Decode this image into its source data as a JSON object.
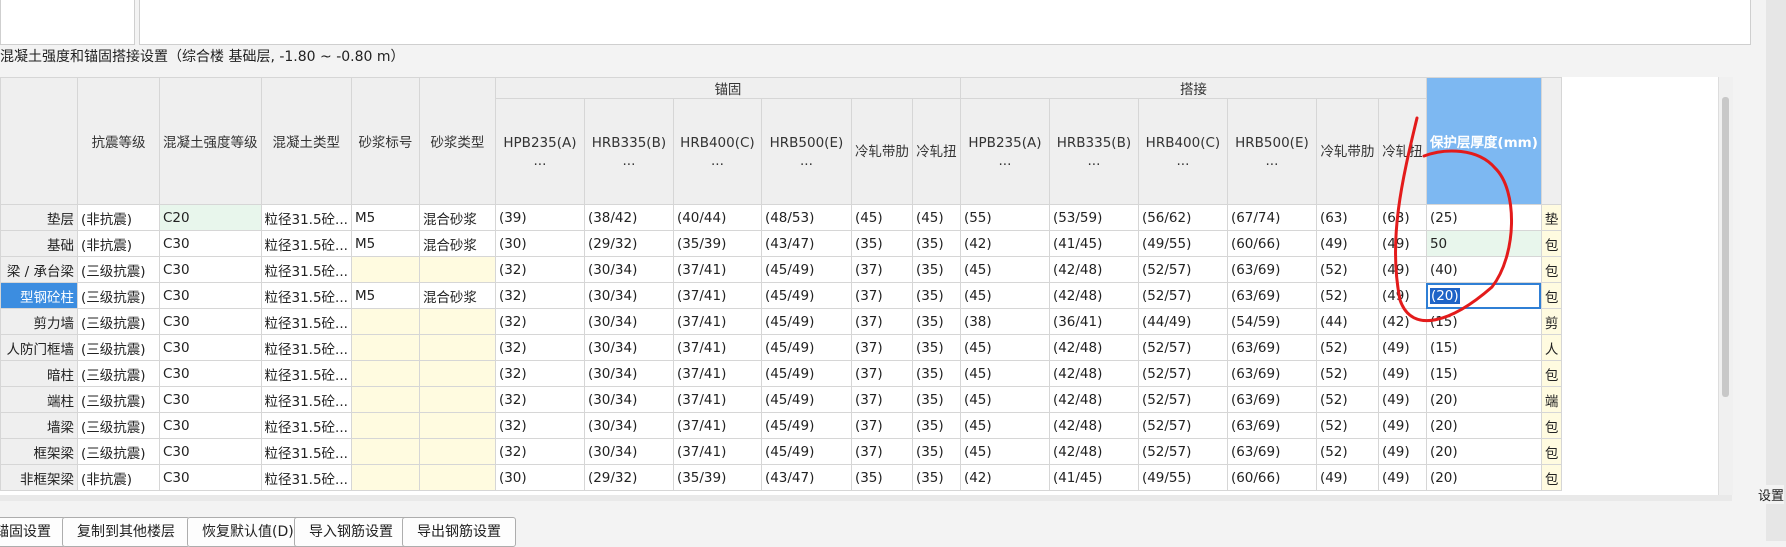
{
  "section_title": "混凝土强度和锚固搭接设置（综合楼  基础层, -1.80 ~ -0.80 m）",
  "table": {
    "group_headers": {
      "anchor": "锚固",
      "lap": "搭接"
    },
    "columns": [
      "",
      "抗震等级",
      "混凝土强度等级",
      "混凝土类型",
      "砂浆标号",
      "砂浆类型",
      "HPB235(A)\n...",
      "HRB335(B)\n...",
      "HRB400(C)\n...",
      "HRB500(E)\n...",
      "冷轧带肋",
      "冷轧扭",
      "HPB235(A)\n...",
      "HRB335(B)\n...",
      "HRB400(C)\n...",
      "HRB500(E)\n...",
      "冷轧带肋",
      "冷轧扭",
      "保护层厚度(mm)",
      ""
    ],
    "rows": [
      [
        "垫层",
        "(非抗震)",
        "C20",
        "粒径31.5砼...",
        "M5",
        "混合砂浆",
        "(39)",
        "(38/42)",
        "(40/44)",
        "(48/53)",
        "(45)",
        "(45)",
        "(55)",
        "(53/59)",
        "(56/62)",
        "(67/74)",
        "(63)",
        "(63)",
        "(25)",
        "垫"
      ],
      [
        "基础",
        "(非抗震)",
        "C30",
        "粒径31.5砼...",
        "M5",
        "混合砂浆",
        "(30)",
        "(29/32)",
        "(35/39)",
        "(43/47)",
        "(35)",
        "(35)",
        "(42)",
        "(41/45)",
        "(49/55)",
        "(60/66)",
        "(49)",
        "(49)",
        "50",
        "包"
      ],
      [
        "梁 / 承台梁",
        "(三级抗震)",
        "C30",
        "粒径31.5砼...",
        "",
        "",
        "(32)",
        "(30/34)",
        "(37/41)",
        "(45/49)",
        "(37)",
        "(35)",
        "(45)",
        "(42/48)",
        "(52/57)",
        "(63/69)",
        "(52)",
        "(49)",
        "(40)",
        "包"
      ],
      [
        "型钢砼柱",
        "(三级抗震)",
        "C30",
        "粒径31.5砼...",
        "M5",
        "混合砂浆",
        "(32)",
        "(30/34)",
        "(37/41)",
        "(45/49)",
        "(37)",
        "(35)",
        "(45)",
        "(42/48)",
        "(52/57)",
        "(63/69)",
        "(52)",
        "(49)",
        "(20)",
        "包"
      ],
      [
        "剪力墙",
        "(三级抗震)",
        "C30",
        "粒径31.5砼...",
        "",
        "",
        "(32)",
        "(30/34)",
        "(37/41)",
        "(45/49)",
        "(37)",
        "(35)",
        "(38)",
        "(36/41)",
        "(44/49)",
        "(54/59)",
        "(44)",
        "(42)",
        "(15)",
        "剪"
      ],
      [
        "人防门框墙",
        "(三级抗震)",
        "C30",
        "粒径31.5砼...",
        "",
        "",
        "(32)",
        "(30/34)",
        "(37/41)",
        "(45/49)",
        "(37)",
        "(35)",
        "(45)",
        "(42/48)",
        "(52/57)",
        "(63/69)",
        "(52)",
        "(49)",
        "(15)",
        "人"
      ],
      [
        "暗柱",
        "(三级抗震)",
        "C30",
        "粒径31.5砼...",
        "",
        "",
        "(32)",
        "(30/34)",
        "(37/41)",
        "(45/49)",
        "(37)",
        "(35)",
        "(45)",
        "(42/48)",
        "(52/57)",
        "(63/69)",
        "(52)",
        "(49)",
        "(15)",
        "包"
      ],
      [
        "端柱",
        "(三级抗震)",
        "C30",
        "粒径31.5砼...",
        "",
        "",
        "(32)",
        "(30/34)",
        "(37/41)",
        "(45/49)",
        "(37)",
        "(35)",
        "(45)",
        "(42/48)",
        "(52/57)",
        "(63/69)",
        "(52)",
        "(49)",
        "(20)",
        "端"
      ],
      [
        "墙梁",
        "(三级抗震)",
        "C30",
        "粒径31.5砼...",
        "",
        "",
        "(32)",
        "(30/34)",
        "(37/41)",
        "(45/49)",
        "(37)",
        "(35)",
        "(45)",
        "(42/48)",
        "(52/57)",
        "(63/69)",
        "(52)",
        "(49)",
        "(20)",
        "包"
      ],
      [
        "框架梁",
        "(三级抗震)",
        "C30",
        "粒径31.5砼...",
        "",
        "",
        "(32)",
        "(30/34)",
        "(37/41)",
        "(45/49)",
        "(37)",
        "(35)",
        "(45)",
        "(42/48)",
        "(52/57)",
        "(63/69)",
        "(52)",
        "(49)",
        "(20)",
        "包"
      ],
      [
        "非框架梁",
        "(非抗震)",
        "C30",
        "粒径31.5砼...",
        "",
        "",
        "(30)",
        "(29/32)",
        "(35/39)",
        "(43/47)",
        "(35)",
        "(35)",
        "(42)",
        "(41/45)",
        "(49/55)",
        "(60/66)",
        "(49)",
        "(49)",
        "(20)",
        "包"
      ]
    ]
  },
  "buttons": [
    "锚固设置",
    "复制到其他楼层",
    "恢复默认值(D)",
    "导入钢筋设置",
    "导出钢筋设置"
  ],
  "right_label": "设置",
  "colors": {
    "selected_header": "#7db8f2",
    "active_row": "#3c8de0",
    "annotation": "#e31b1b",
    "yellow_cell": "#fffbe0",
    "green_cell": "#e8f6ec"
  }
}
